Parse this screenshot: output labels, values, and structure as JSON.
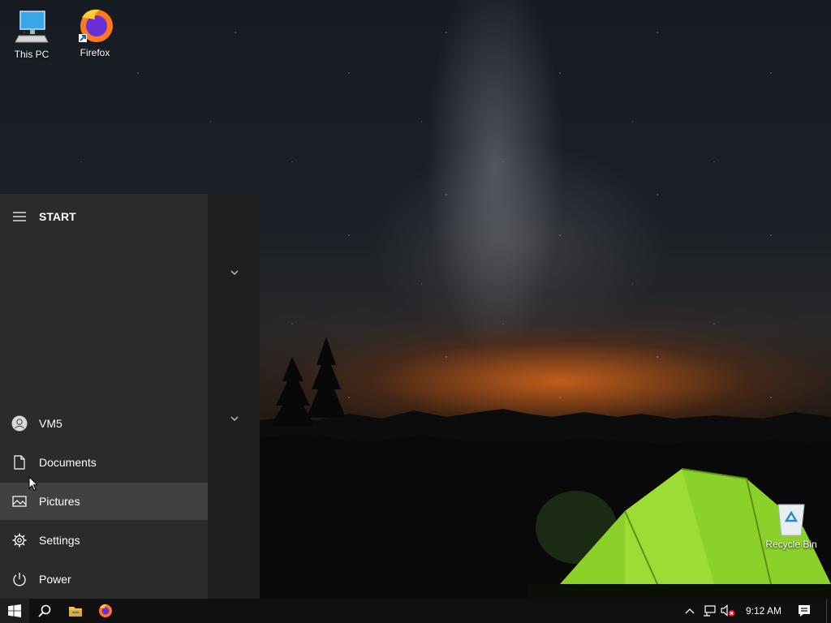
{
  "desktop": {
    "icons": [
      {
        "label": "This PC",
        "icon": "computer-icon"
      },
      {
        "label": "Firefox",
        "icon": "firefox-icon"
      },
      {
        "label": "Recycle Bin",
        "icon": "recycle-bin-icon"
      }
    ]
  },
  "start_menu": {
    "title": "START",
    "items": [
      {
        "label": "VM5",
        "icon": "user-avatar-icon"
      },
      {
        "label": "Documents",
        "icon": "document-icon"
      },
      {
        "label": "Pictures",
        "icon": "pictures-icon"
      },
      {
        "label": "Settings",
        "icon": "gear-icon"
      },
      {
        "label": "Power",
        "icon": "power-icon"
      }
    ],
    "hovered_item": "Pictures"
  },
  "taskbar": {
    "pinned": [
      "windows-start-icon",
      "search-icon",
      "file-explorer-icon",
      "firefox-icon"
    ],
    "tray": [
      "chevron-up-icon",
      "network-icon",
      "volume-muted-icon"
    ],
    "clock": "9:12 AM",
    "notifications_icon": "action-center-icon"
  },
  "colors": {
    "start_bg": "#2b2b2b",
    "hover_bg": "#414141",
    "taskbar_bg": "#101010",
    "tent_green": "#8bd12a",
    "horizon_orange": "#eb6e19"
  }
}
